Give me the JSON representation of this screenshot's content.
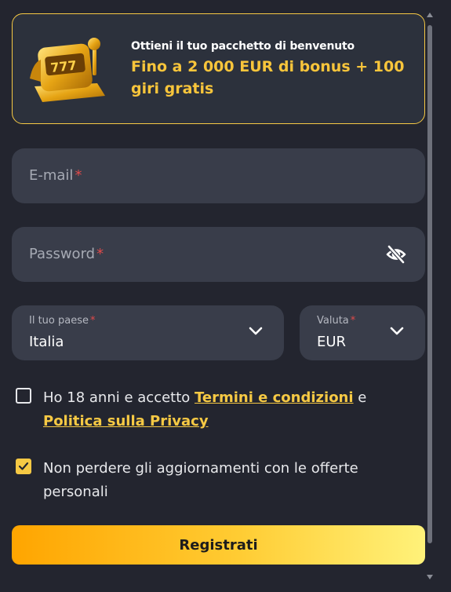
{
  "promo": {
    "subtitle": "Ottieni il tuo pacchetto di benvenuto",
    "headline": "Fino a 2 000 EUR di bonus + 100 giri gratis",
    "image_icon": "slot-machine-777-icon",
    "slot_digits": "777"
  },
  "form": {
    "email": {
      "placeholder": "E-mail",
      "required_mark": "*"
    },
    "password": {
      "placeholder": "Password",
      "required_mark": "*",
      "toggle_icon": "eye-off-icon"
    },
    "country": {
      "label": "Il tuo paese",
      "required_mark": "*",
      "value": "Italia"
    },
    "currency": {
      "label": "Valuta",
      "required_mark": "*",
      "value": "EUR"
    },
    "terms": {
      "text_before": "Ho 18 anni e accetto ",
      "terms_link": "Termini e condizioni",
      "text_between": " e ",
      "privacy_link": "Politica sulla Privacy",
      "checked": false
    },
    "offers": {
      "text": "Non perdere gli aggiornamenti con le offerte personali",
      "checked": true
    },
    "submit_label": "Registrati"
  },
  "colors": {
    "background": "#23252f",
    "field": "#393d4a",
    "accent": "#f6c944",
    "required": "#e04a4a"
  }
}
